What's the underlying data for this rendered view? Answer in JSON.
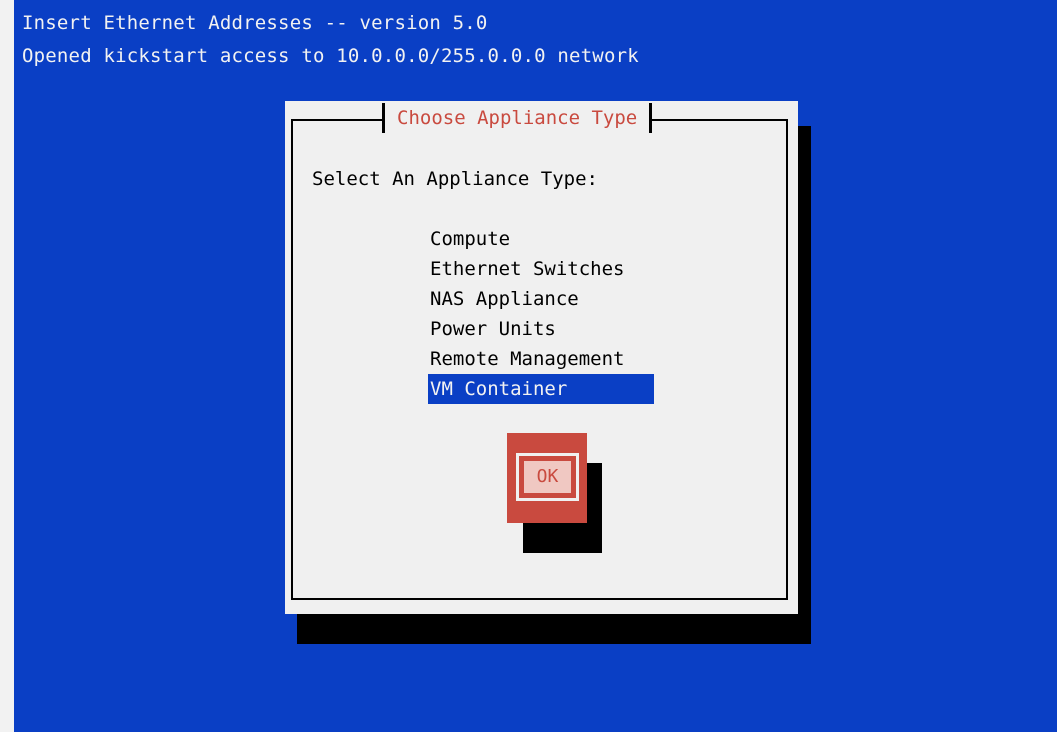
{
  "header": {
    "line1": "Insert Ethernet Addresses -- version 5.0",
    "line2": "Opened kickstart access to 10.0.0.0/255.0.0.0 network"
  },
  "dialog": {
    "title": "Choose Appliance Type",
    "prompt": "Select An Appliance Type:",
    "items": [
      {
        "label": "Compute",
        "selected": false
      },
      {
        "label": "Ethernet Switches",
        "selected": false
      },
      {
        "label": "NAS Appliance",
        "selected": false
      },
      {
        "label": "Power Units",
        "selected": false
      },
      {
        "label": "Remote Management",
        "selected": false
      },
      {
        "label": "VM Container",
        "selected": true
      }
    ],
    "ok_label": "OK"
  },
  "colors": {
    "screen_bg": "#0a3fc5",
    "dialog_bg": "#f0f0f0",
    "accent_red": "#c94a3f",
    "selection_bg": "#0a3fc5"
  }
}
